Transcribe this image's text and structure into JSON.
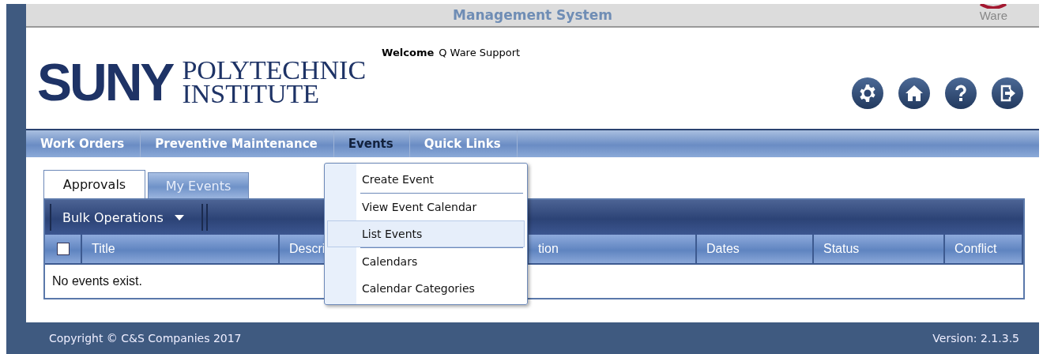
{
  "top_bar": {
    "title": "Management System",
    "logo_text": "Ware"
  },
  "header": {
    "logo": {
      "main": "SUNY",
      "line_1": "POLYTECHNIC",
      "line_2": "INSTITUTE"
    },
    "welcome_label": "Welcome",
    "user": "Q Ware Support"
  },
  "toolbar_icons": [
    {
      "kind": "settings"
    },
    {
      "kind": "home"
    },
    {
      "kind": "help"
    },
    {
      "kind": "logout"
    }
  ],
  "nav": [
    {
      "label": "Work Orders",
      "selected": false
    },
    {
      "label": "Preventive Maintenance",
      "selected": false
    },
    {
      "label": "Events",
      "selected": true
    },
    {
      "label": "Quick Links",
      "selected": false
    }
  ],
  "events_menu": [
    {
      "label": "Create Event",
      "selected": false,
      "separator": true
    },
    {
      "label": "View Event Calendar",
      "selected": false,
      "separator": false
    },
    {
      "label": "List Events",
      "selected": true,
      "separator": true
    },
    {
      "label": "Calendars",
      "selected": false,
      "separator": false
    },
    {
      "label": "Calendar Categories",
      "selected": false,
      "separator": false
    }
  ],
  "tabs": [
    {
      "label": "Approvals",
      "selected": true
    },
    {
      "label": "My Events",
      "selected": false
    }
  ],
  "grid": {
    "bulk_button": "Bulk Operations",
    "select_all": {
      "checked": false
    },
    "columns": [
      {
        "label": "Title"
      },
      {
        "label": "Descri"
      },
      {
        "label": "tion"
      },
      {
        "label": "Dates"
      },
      {
        "label": "Status"
      },
      {
        "label": "Conflict"
      }
    ],
    "empty_message": "No events exist."
  },
  "footer": {
    "copyright": "Copyright © C&S Companies 2017",
    "version": "Version: 2.1.3.5"
  }
}
